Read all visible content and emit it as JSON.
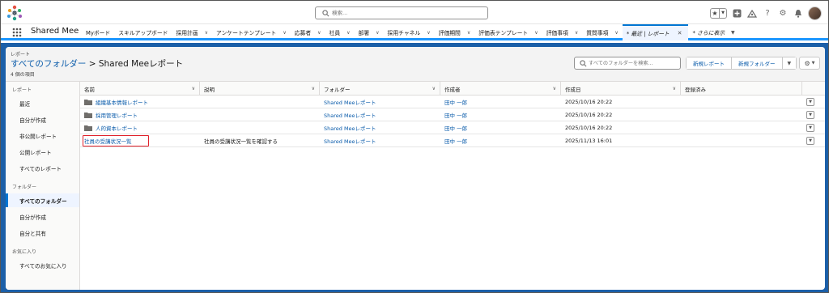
{
  "header": {
    "search_placeholder": "検索..."
  },
  "nav": {
    "app_name": "Shared Mee",
    "items": [
      {
        "label": "Myボード",
        "chevron": false
      },
      {
        "label": "スキルアップボード",
        "chevron": false
      },
      {
        "label": "採用計画",
        "chevron": true
      },
      {
        "label": "アンケートテンプレート",
        "chevron": true
      },
      {
        "label": "応募者",
        "chevron": true
      },
      {
        "label": "社員",
        "chevron": true
      },
      {
        "label": "部署",
        "chevron": true
      },
      {
        "label": "採用チャネル",
        "chevron": true
      },
      {
        "label": "評価期間",
        "chevron": true
      },
      {
        "label": "評価表テンプレート",
        "chevron": true
      },
      {
        "label": "評価事項",
        "chevron": true
      },
      {
        "label": "質問事項",
        "chevron": true
      }
    ],
    "active_tab": "* 最近 | レポート",
    "more_label": "* さらに表示"
  },
  "page": {
    "eyebrow": "レポート",
    "title_link": "すべてのフォルダー",
    "title_sep": " > ",
    "title_rest": "Shared Meeレポート",
    "count": "4 個の項目",
    "search_placeholder": "すべてのフォルダーを検索...",
    "new_report": "新規レポート",
    "new_folder": "新規フォルダー"
  },
  "sidebar": {
    "group_reports": "レポート",
    "reports": [
      "最近",
      "自分が作成",
      "非公開レポート",
      "公開レポート",
      "すべてのレポート"
    ],
    "group_folders": "フォルダー",
    "folders": [
      "すべてのフォルダー",
      "自分が作成",
      "自分と共有"
    ],
    "group_favorites": "お気に入り",
    "favorites": [
      "すべてのお気に入り"
    ]
  },
  "table": {
    "columns": [
      "名前",
      "説明",
      "フォルダー",
      "作成者",
      "作成日",
      "登録済み"
    ],
    "rows": [
      {
        "name": "組織基本情報レポート",
        "folder_icon": true,
        "description": "",
        "folder": "Shared Meeレポート",
        "owner": "田中 一郎",
        "date": "2025/10/16 20:22"
      },
      {
        "name": "採用管理レポート",
        "folder_icon": true,
        "description": "",
        "folder": "Shared Meeレポート",
        "owner": "田中 一郎",
        "date": "2025/10/16 20:22"
      },
      {
        "name": "人的資本レポート",
        "folder_icon": true,
        "description": "",
        "folder": "Shared Meeレポート",
        "owner": "田中 一郎",
        "date": "2025/10/16 20:22"
      },
      {
        "name": "社員の受講状況一覧",
        "folder_icon": false,
        "description": "社員の受講状況一覧を確認する",
        "folder": "Shared Meeレポート",
        "owner": "田中 一郎",
        "date": "2025/11/13 16:01"
      }
    ]
  },
  "colors": {
    "brand_blue": "#1b5fa8",
    "link": "#0b5cab",
    "accent": "#1b96ff",
    "highlight": "#e0212b"
  }
}
